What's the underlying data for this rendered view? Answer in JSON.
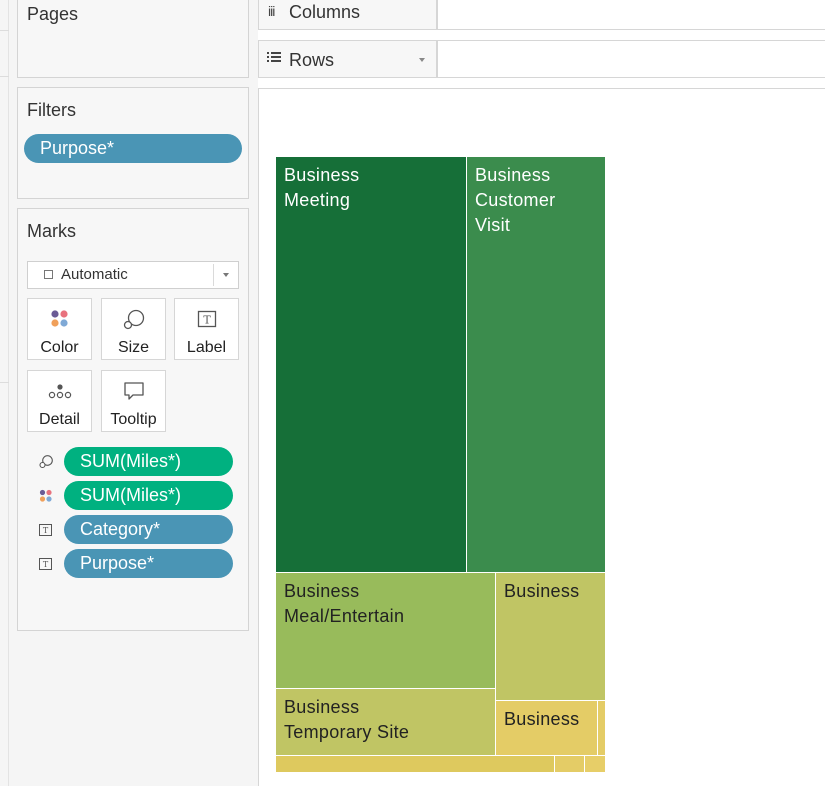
{
  "pages_card": {
    "title": "Pages"
  },
  "filters_card": {
    "title": "Filters",
    "pills": [
      "Purpose*"
    ]
  },
  "marks_card": {
    "title": "Marks",
    "mark_type": "Automatic",
    "buttons": [
      "Color",
      "Size",
      "Label",
      "Detail",
      "Tooltip"
    ],
    "fields": [
      {
        "icon": "size-icon",
        "label": "SUM(Miles*)",
        "kind": "measure"
      },
      {
        "icon": "color-icon",
        "label": "SUM(Miles*)",
        "kind": "measure"
      },
      {
        "icon": "label-icon",
        "label": "Category*",
        "kind": "dimension"
      },
      {
        "icon": "label-icon",
        "label": "Purpose*",
        "kind": "dimension"
      }
    ]
  },
  "shelves": {
    "columns": "Columns",
    "rows": "Rows"
  },
  "colors": {
    "dimension_pill": "#4a95b5",
    "measure_pill": "#00b180"
  },
  "treemap": {
    "cells": [
      {
        "line1": "Business",
        "line2": "Meeting",
        "line3": "",
        "color": "#166f38"
      },
      {
        "line1": "Business",
        "line2": "Customer",
        "line3": "Visit",
        "color": "#3b8c4d"
      },
      {
        "line1": "Business",
        "line2": "Meal/Entertain",
        "line3": "",
        "color": "#98bb5b"
      },
      {
        "line1": "Business",
        "line2": "",
        "line3": "",
        "color": "#c0c564"
      },
      {
        "line1": "Business",
        "line2": "Temporary Site",
        "line3": "",
        "color": "#c0c564"
      },
      {
        "line1": "Business",
        "line2": "",
        "line3": "",
        "color": "#e4cc66"
      },
      {
        "line1": "",
        "line2": "",
        "line3": "",
        "color": "#e4cc66"
      },
      {
        "line1": "",
        "line2": "",
        "line3": "",
        "color": "#dec95e"
      },
      {
        "line1": "",
        "line2": "",
        "line3": "",
        "color": "#e4cc66"
      },
      {
        "line1": "",
        "line2": "",
        "line3": "",
        "color": "#e7ce68"
      }
    ]
  }
}
